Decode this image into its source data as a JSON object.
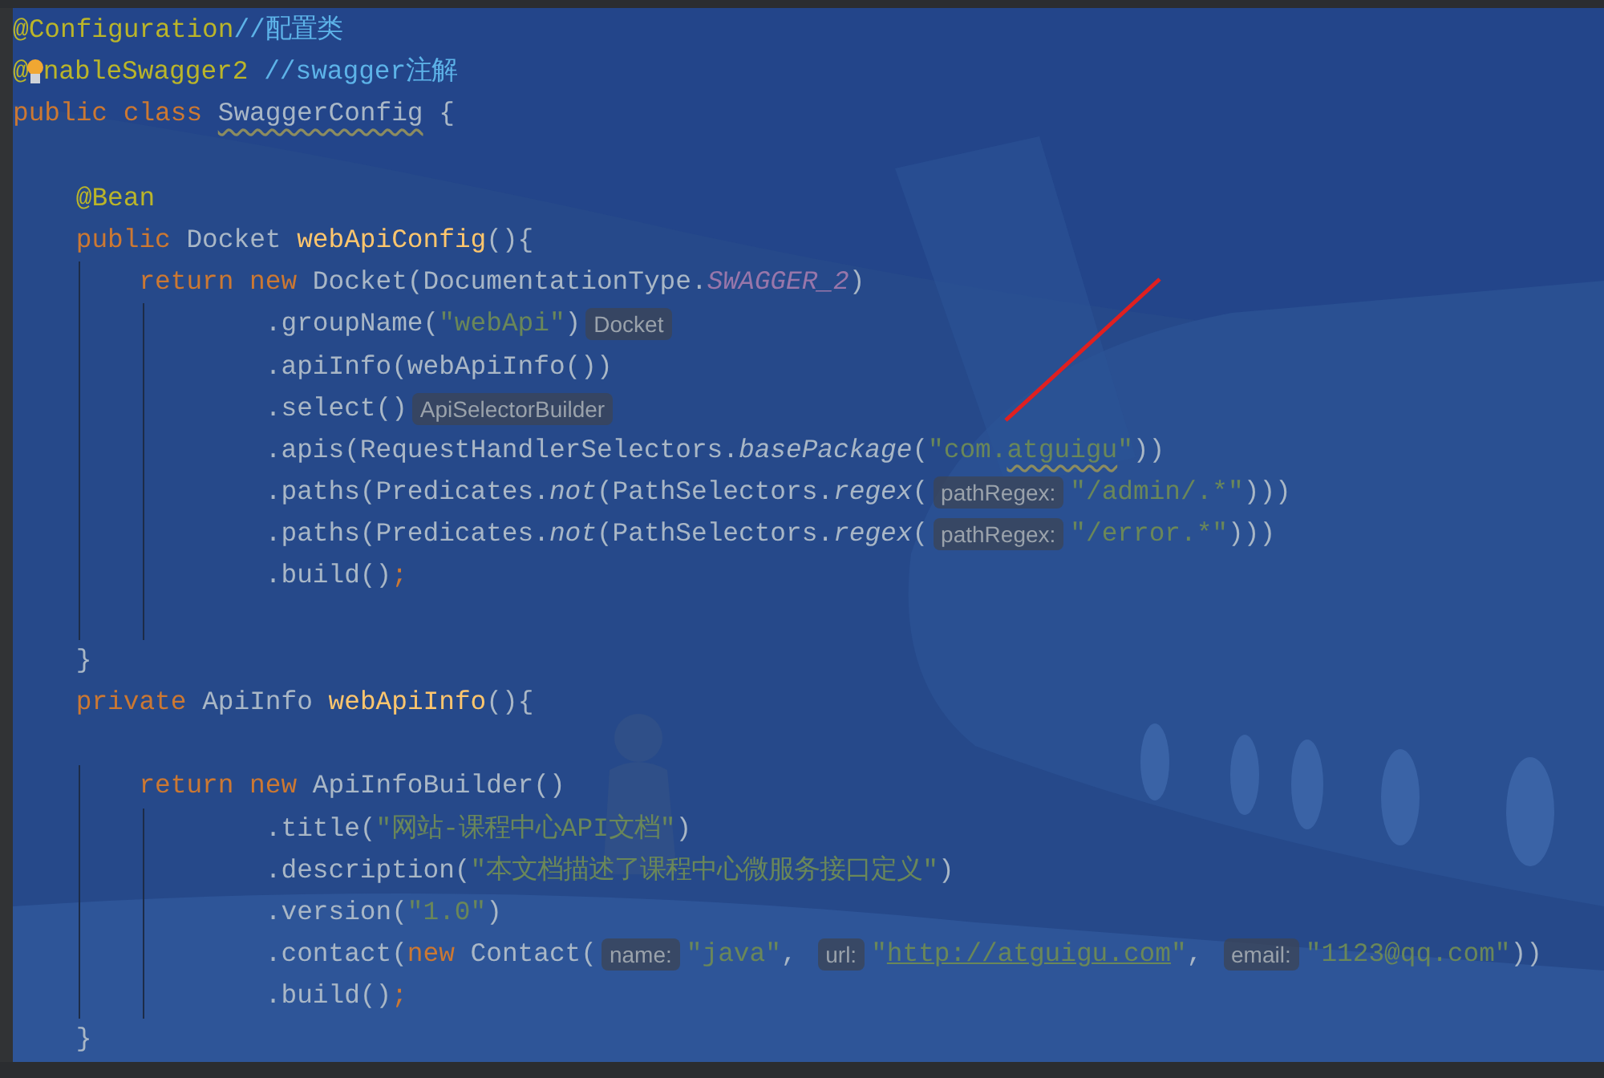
{
  "editor": {
    "lines": [
      {
        "tokens": [
          {
            "kind": "annotation",
            "text": "@Configuration"
          },
          {
            "kind": "comment",
            "text": "//配置类"
          }
        ]
      },
      {
        "tokens": [
          {
            "kind": "annotation",
            "text": "@"
          },
          {
            "kind": "bulb"
          },
          {
            "kind": "annotation",
            "text": "nableSwagger2 "
          },
          {
            "kind": "comment",
            "text": "//swagger注解"
          }
        ]
      },
      {
        "tokens": [
          {
            "kind": "keyword",
            "text": "public class "
          },
          {
            "kind": "warn",
            "text": "SwaggerConfig"
          },
          {
            "kind": "plain",
            "text": " {"
          }
        ]
      },
      {
        "blank": true
      },
      {
        "tokens": [
          {
            "kind": "annotation",
            "text": "    @Bean"
          }
        ]
      },
      {
        "tokens": [
          {
            "kind": "keyword",
            "text": "    public "
          },
          {
            "kind": "plain",
            "text": "Docket "
          },
          {
            "kind": "method",
            "text": "webApiConfig"
          },
          {
            "kind": "plain",
            "text": "(){"
          }
        ]
      },
      {
        "tokens": [
          {
            "kind": "keyword",
            "text": "        return new "
          },
          {
            "kind": "plain",
            "text": "Docket(DocumentationType."
          },
          {
            "kind": "static",
            "text": "SWAGGER_2"
          },
          {
            "kind": "plain",
            "text": ")"
          }
        ]
      },
      {
        "tokens": [
          {
            "kind": "plain",
            "text": "                .groupName("
          },
          {
            "kind": "string",
            "text": "\"webApi\""
          },
          {
            "kind": "plain",
            "text": ")"
          },
          {
            "kind": "hint",
            "text": "Docket"
          }
        ]
      },
      {
        "tokens": [
          {
            "kind": "plain",
            "text": "                .apiInfo(webApiInfo())"
          }
        ]
      },
      {
        "tokens": [
          {
            "kind": "plain",
            "text": "                .select()"
          },
          {
            "kind": "hint",
            "text": "ApiSelectorBuilder"
          }
        ]
      },
      {
        "tokens": [
          {
            "kind": "plain",
            "text": "                .apis(RequestHandlerSelectors."
          },
          {
            "kind": "italic",
            "text": "basePackage"
          },
          {
            "kind": "plain",
            "text": "("
          },
          {
            "kind": "string",
            "text": "\"com."
          },
          {
            "kind": "string-warn",
            "text": "atguigu"
          },
          {
            "kind": "string",
            "text": "\""
          },
          {
            "kind": "plain",
            "text": "))"
          }
        ]
      },
      {
        "tokens": [
          {
            "kind": "plain",
            "text": "                .paths(Predicates."
          },
          {
            "kind": "italic",
            "text": "not"
          },
          {
            "kind": "plain",
            "text": "(PathSelectors."
          },
          {
            "kind": "italic",
            "text": "regex"
          },
          {
            "kind": "plain",
            "text": "("
          },
          {
            "kind": "hint",
            "text": "pathRegex:"
          },
          {
            "kind": "string",
            "text": "\"/admin/.*\""
          },
          {
            "kind": "plain",
            "text": ")))"
          }
        ]
      },
      {
        "tokens": [
          {
            "kind": "plain",
            "text": "                .paths(Predicates."
          },
          {
            "kind": "italic",
            "text": "not"
          },
          {
            "kind": "plain",
            "text": "(PathSelectors."
          },
          {
            "kind": "italic",
            "text": "regex"
          },
          {
            "kind": "plain",
            "text": "("
          },
          {
            "kind": "hint",
            "text": "pathRegex:"
          },
          {
            "kind": "string",
            "text": "\"/error.*\""
          },
          {
            "kind": "plain",
            "text": ")))"
          }
        ]
      },
      {
        "tokens": [
          {
            "kind": "plain",
            "text": "                .build()"
          },
          {
            "kind": "keyword",
            "text": ";"
          }
        ]
      },
      {
        "blank": true
      },
      {
        "tokens": [
          {
            "kind": "plain",
            "text": "    }"
          }
        ]
      },
      {
        "tokens": [
          {
            "kind": "keyword",
            "text": "    private "
          },
          {
            "kind": "plain",
            "text": "ApiInfo "
          },
          {
            "kind": "method",
            "text": "webApiInfo"
          },
          {
            "kind": "plain",
            "text": "(){"
          }
        ]
      },
      {
        "blank": true
      },
      {
        "tokens": [
          {
            "kind": "keyword",
            "text": "        return new "
          },
          {
            "kind": "plain",
            "text": "ApiInfoBuilder()"
          }
        ]
      },
      {
        "tokens": [
          {
            "kind": "plain",
            "text": "                .title("
          },
          {
            "kind": "string",
            "text": "\"网站-课程中心API文档\""
          },
          {
            "kind": "plain",
            "text": ")"
          }
        ]
      },
      {
        "tokens": [
          {
            "kind": "plain",
            "text": "                .description("
          },
          {
            "kind": "string",
            "text": "\"本文档描述了课程中心微服务接口定义\""
          },
          {
            "kind": "plain",
            "text": ")"
          }
        ]
      },
      {
        "tokens": [
          {
            "kind": "plain",
            "text": "                .version("
          },
          {
            "kind": "string",
            "text": "\"1.0\""
          },
          {
            "kind": "plain",
            "text": ")"
          }
        ]
      },
      {
        "tokens": [
          {
            "kind": "plain",
            "text": "                .contact("
          },
          {
            "kind": "keyword",
            "text": "new "
          },
          {
            "kind": "plain",
            "text": "Contact("
          },
          {
            "kind": "hint",
            "text": "name:"
          },
          {
            "kind": "string",
            "text": "\"java\""
          },
          {
            "kind": "plain",
            "text": ", "
          },
          {
            "kind": "hint",
            "text": "url:"
          },
          {
            "kind": "string",
            "text": "\""
          },
          {
            "kind": "link",
            "text": "http://atguigu.com"
          },
          {
            "kind": "string",
            "text": "\""
          },
          {
            "kind": "plain",
            "text": ", "
          },
          {
            "kind": "hint",
            "text": "email:"
          },
          {
            "kind": "string",
            "text": "\"1123@qq.com\""
          },
          {
            "kind": "plain",
            "text": "))"
          }
        ]
      },
      {
        "tokens": [
          {
            "kind": "plain",
            "text": "                .build()"
          },
          {
            "kind": "keyword",
            "text": ";"
          }
        ]
      },
      {
        "tokens": [
          {
            "kind": "plain",
            "text": "    }"
          }
        ]
      }
    ]
  }
}
